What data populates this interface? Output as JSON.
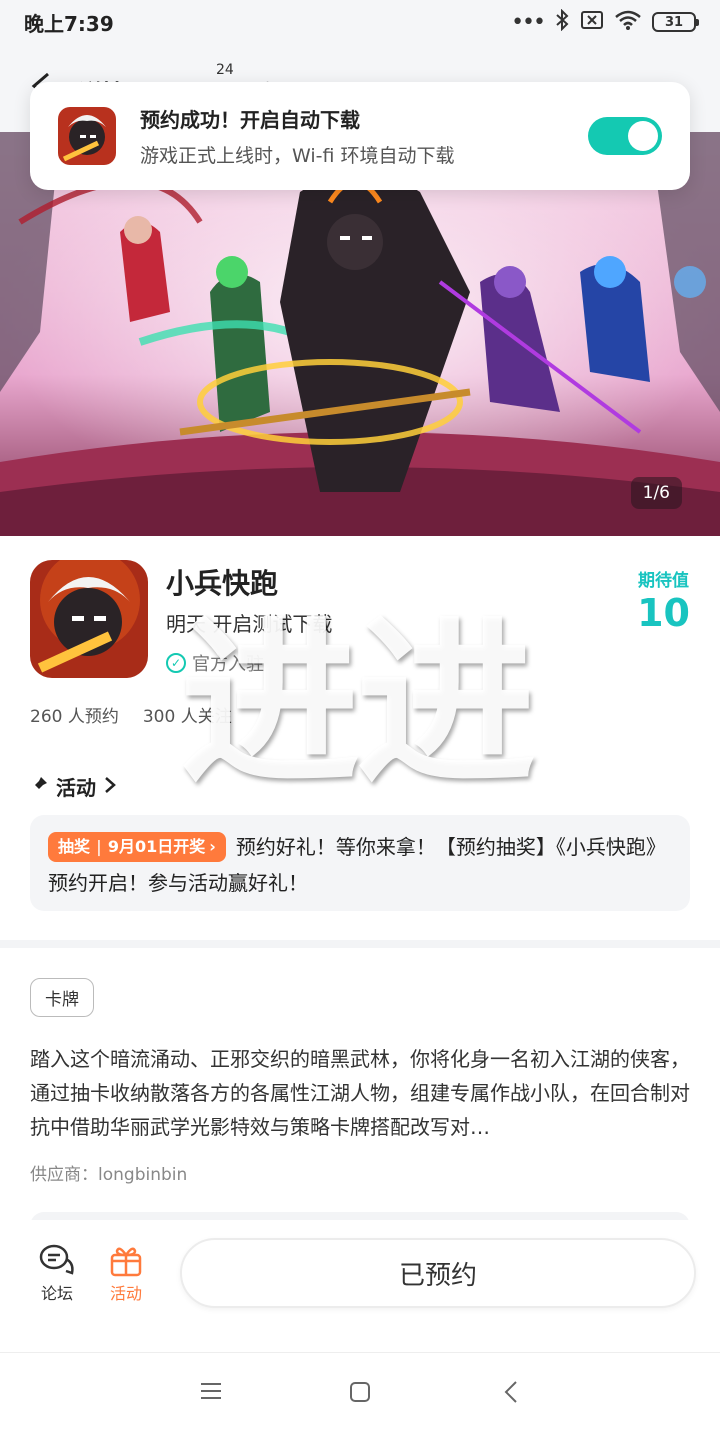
{
  "status_bar": {
    "time": "晚上7:39",
    "battery": "31",
    "signal_dots": "•••"
  },
  "header": {
    "tab_detail": "详情",
    "tab_reviews": "评价",
    "review_count": "24",
    "tab_forum": "论坛"
  },
  "toast": {
    "title": "预约成功！开启自动下载",
    "subtitle": "游戏正式上线时，Wi-fi 环境自动下载",
    "toggle_on": true
  },
  "banner": {
    "counter": "1/6"
  },
  "game": {
    "name": "小兵快跑",
    "subtitle": "明天 开启测试下载",
    "official": "官方入驻",
    "expect_label": "期待值",
    "expect_value": "10",
    "reservations": "260 人预约",
    "followers": "300 人关注"
  },
  "watermark": "进进",
  "activity": {
    "heading": "活动",
    "lottery_tag": "抽奖",
    "lottery_date": "9月01日开奖",
    "text": "预约好礼！等你来拿！【预约抽奖】《小兵快跑》预约开启！参与活动赢好礼！"
  },
  "details": {
    "tag": "卡牌",
    "description": "踏入这个暗流涌动、正邪交织的暗黑武林，你将化身一名初入江湖的侠客，通过抽卡收纳散落各方的各属性江湖人物，组建专属作战小队，在回合制对抗中借助华丽武学光影特效与策略卡牌搭配改写对…",
    "supplier": "供应商：longbinbin"
  },
  "bottom_bar": {
    "forum_label": "论坛",
    "activity_label": "活动",
    "reserved_label": "已预约"
  },
  "colors": {
    "accent": "#14c9b2",
    "orange": "#ff7a3c",
    "expect": "#19c4c0"
  }
}
